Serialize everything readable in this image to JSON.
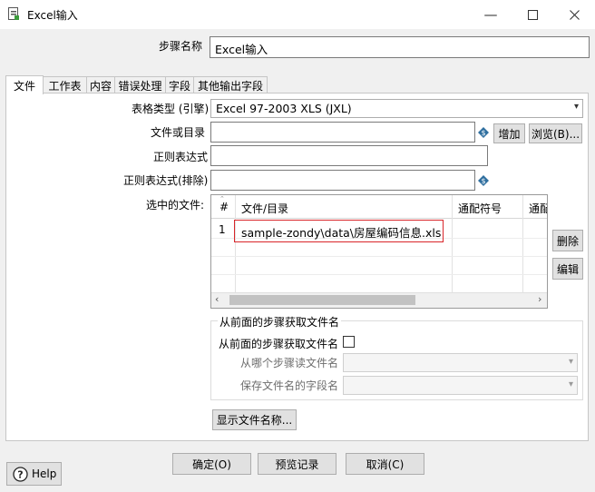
{
  "window": {
    "title": "Excel输入",
    "icon": "document-icon"
  },
  "step_name": {
    "label": "步骤名称",
    "value": "Excel输入"
  },
  "tabs": [
    {
      "label": "文件",
      "active": true
    },
    {
      "label": "工作表",
      "active": false
    },
    {
      "label": "内容",
      "active": false
    },
    {
      "label": "错误处理",
      "active": false
    },
    {
      "label": "字段",
      "active": false
    },
    {
      "label": "其他输出字段",
      "active": false
    }
  ],
  "form": {
    "table_type_label": "表格类型 (引擎)",
    "table_type_value": "Excel 97-2003 XLS (JXL)",
    "file_dir_label": "文件或目录",
    "file_dir_value": "",
    "add_button": "增加",
    "browse_button": "浏览(B)...",
    "regex_label": "正则表达式",
    "regex_value": "",
    "regex_exclude_label": "正则表达式(排除)",
    "regex_exclude_value": "",
    "selected_files_label": "选中的文件:"
  },
  "files_table": {
    "columns": [
      "#",
      "文件/目录",
      "通配符号",
      "通配"
    ],
    "rows": [
      {
        "index": "1",
        "path": "sample-zondy\\data\\房屋编码信息.xls",
        "wildcard": ""
      }
    ],
    "highlight_color": "#d9262a"
  },
  "side_buttons": {
    "delete": "删除",
    "edit": "编辑"
  },
  "from_previous": {
    "group_title": "从前面的步骤获取文件名",
    "checkbox_label": "从前面的步骤获取文件名",
    "checked": false,
    "step_label": "从哪个步骤读文件名",
    "field_label": "保存文件名的字段名"
  },
  "show_filenames_button": "显示文件名称...",
  "footer": {
    "ok": "确定(O)",
    "preview": "预览记录",
    "cancel": "取消(C)",
    "help": "Help"
  }
}
